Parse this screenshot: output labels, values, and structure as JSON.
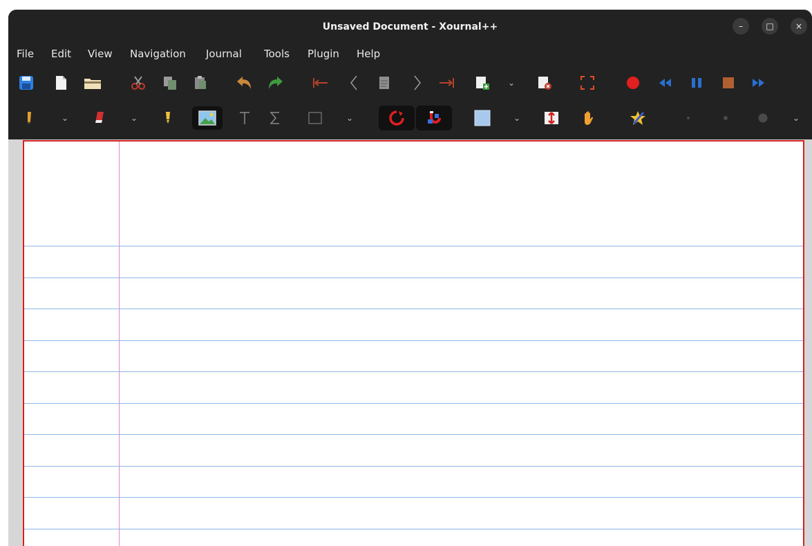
{
  "window": {
    "title": "Unsaved Document - Xournal++",
    "controls": {
      "minimize": "–",
      "maximize": "□",
      "close": "×"
    }
  },
  "menu": {
    "items": [
      "File",
      "Edit",
      "View",
      "Navigation",
      "Journal",
      "Tools",
      "Plugin",
      "Help"
    ]
  },
  "toolbar1": {
    "icons": [
      "save-icon",
      "new-document-icon",
      "open-folder-icon",
      "cut-icon",
      "copy-icon",
      "paste-icon",
      "undo-icon",
      "redo-icon",
      "goto-first-page-icon",
      "previous-page-icon",
      "goto-page-icon",
      "next-page-icon",
      "goto-last-page-icon",
      "add-page-icon",
      "delete-page-icon",
      "fullscreen-icon",
      "record-icon",
      "rewind-icon",
      "pause-icon",
      "stop-icon",
      "fast-forward-icon"
    ]
  },
  "toolbar2": {
    "icons": [
      "pen-icon",
      "eraser-icon",
      "highlighter-icon",
      "image-icon",
      "text-icon",
      "math-tex-icon",
      "shape-icon",
      "rotation-snapping-icon",
      "grid-snapping-icon",
      "fill-color-icon",
      "vertical-space-icon",
      "hand-icon",
      "select-region-icon",
      "thickness-thin-icon",
      "thickness-medium-icon",
      "thickness-thick-icon"
    ],
    "active": [
      "image-icon",
      "rotation-snapping-icon",
      "grid-snapping-icon"
    ],
    "chevron": "⌄"
  },
  "colors": {
    "window_bg": "#222222",
    "canvas_bg": "#d6d6d6",
    "page_border": "#d42020",
    "ruling": "#8fb6e8",
    "margin_line": "#e08ac8"
  }
}
